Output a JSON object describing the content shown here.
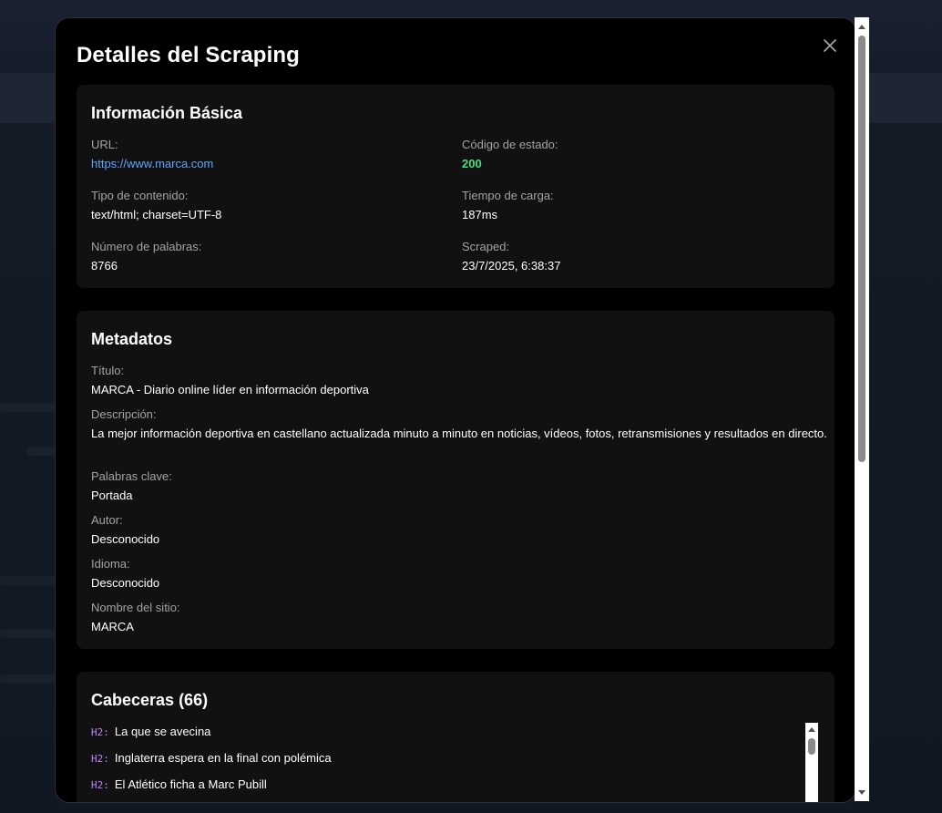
{
  "modal": {
    "title": "Detalles del Scraping"
  },
  "basic": {
    "title": "Información Básica",
    "url_label": "URL:",
    "url_value": "https://www.marca.com",
    "status_label": "Código de estado:",
    "status_value": "200",
    "content_type_label": "Tipo de contenido:",
    "content_type_value": "text/html; charset=UTF-8",
    "load_time_label": "Tiempo de carga:",
    "load_time_value": "187ms",
    "word_count_label": "Número de palabras:",
    "word_count_value": "8766",
    "scraped_label": "Scraped:",
    "scraped_value": "23/7/2025, 6:38:37"
  },
  "metadata": {
    "title": "Metadatos",
    "title_label": "Título:",
    "title_value": "MARCA - Diario online líder en información deportiva",
    "description_label": "Descripción:",
    "description_value": "La mejor información deportiva en castellano actualizada minuto a minuto en noticias, vídeos, fotos, retransmisiones y resultados en directo.",
    "keywords_label": "Palabras clave:",
    "keywords_value": "Portada",
    "author_label": "Autor:",
    "author_value": "Desconocido",
    "language_label": "Idioma:",
    "language_value": "Desconocido",
    "site_name_label": "Nombre del sitio:",
    "site_name_value": "MARCA"
  },
  "headings": {
    "title": "Cabeceras (66)",
    "items": [
      {
        "tag": "H2:",
        "text": "La que se avecina"
      },
      {
        "tag": "H2:",
        "text": "Inglaterra espera en la final con polémica"
      },
      {
        "tag": "H2:",
        "text": "El Atlético ficha a Marc Pubill"
      }
    ]
  },
  "colors": {
    "link": "#60a5fa",
    "status_ok": "#4ade80",
    "heading_tag": "#c084fc"
  },
  "icons": {
    "close": "close-icon",
    "scroll_up": "chevron-up-icon",
    "scroll_down": "chevron-down-icon"
  }
}
